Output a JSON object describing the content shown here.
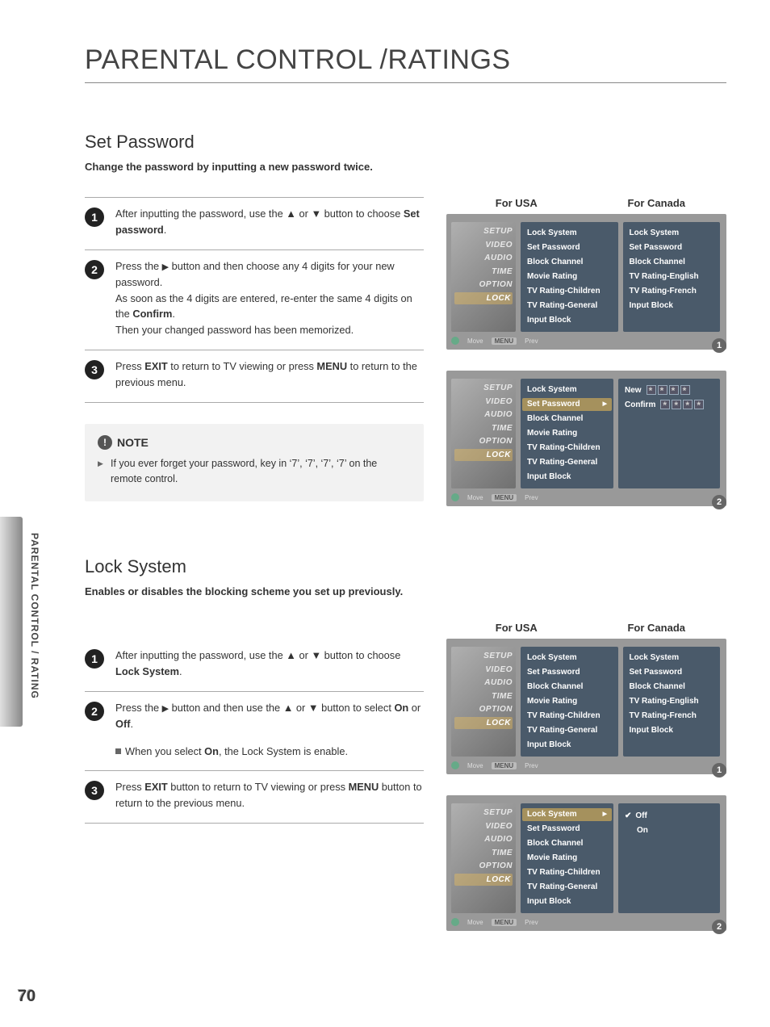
{
  "page": {
    "title": "PARENTAL CONTROL /RATINGS",
    "side_label": "PARENTAL CONTROL / RATING",
    "number": "70"
  },
  "set_password": {
    "title": "Set Password",
    "subtitle": "Change the password by inputting a new password twice.",
    "steps": {
      "s1_a": "After inputting the password, use the ",
      "s1_b": " or ",
      "s1_c": " button to choose ",
      "s1_d": "Set password",
      "s1_e": ".",
      "s2_a": "Press the ",
      "s2_b": " button and then choose any 4 digits for your new password.",
      "s2_c": "As soon as the 4 digits are entered, re-enter the same 4 digits on the ",
      "s2_d": "Confirm",
      "s2_e": ".",
      "s2_f": "Then your changed password has been memorized.",
      "s3_a": "Press ",
      "s3_b": "EXIT",
      "s3_c": " to return to TV viewing or press ",
      "s3_d": "MENU",
      "s3_e": " to return to the previous menu."
    },
    "note": {
      "head": "NOTE",
      "body": "If you ever forget your password, key in ‘7’, ‘7’, ‘7’, ‘7’ on the remote control."
    }
  },
  "lock_system": {
    "title": "Lock System",
    "subtitle": "Enables or disables the blocking scheme you set up previously.",
    "steps": {
      "s1_a": "After inputting the password, use the ",
      "s1_b": " or ",
      "s1_c": " button to choose ",
      "s1_d": "Lock System",
      "s1_e": ".",
      "s2_a": "Press the ",
      "s2_b": " button and then use the ",
      "s2_c": " or ",
      "s2_d": " button to select ",
      "s2_e": "On",
      "s2_f": " or ",
      "s2_g": "Off",
      "s2_h": ".",
      "s2_i": "When you select ",
      "s2_j": "On",
      "s2_k": ", the Lock System is enable.",
      "s3_a": "Press ",
      "s3_b": "EXIT",
      "s3_c": " button to return to TV viewing or press ",
      "s3_d": "MENU",
      "s3_e": " button to return to the previous menu."
    }
  },
  "tv": {
    "header_usa": "For USA",
    "header_canada": "For Canada",
    "sidebar": [
      "SETUP",
      "VIDEO",
      "AUDIO",
      "TIME",
      "OPTION",
      "LOCK"
    ],
    "footer_move": "Move",
    "footer_prev_box": "MENU",
    "footer_prev": "Prev",
    "menu_usa": [
      "Lock System",
      "Set Password",
      "Block Channel",
      "Movie Rating",
      "TV Rating-Children",
      "TV Rating-General",
      "Input Block"
    ],
    "menu_canada": [
      "Lock System",
      "Set Password",
      "Block Channel",
      "TV Rating-English",
      "TV Rating-French",
      "Input Block"
    ],
    "pwd_new": "New",
    "pwd_confirm": "Confirm",
    "opt_off": "Off",
    "opt_on": "On"
  }
}
